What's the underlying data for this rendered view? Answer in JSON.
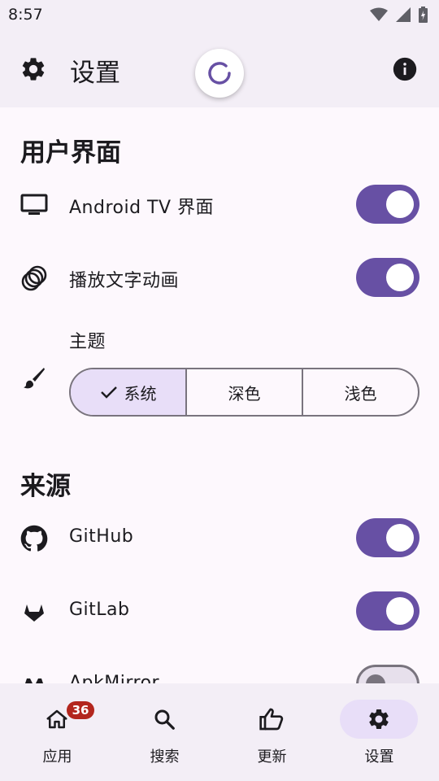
{
  "status_bar": {
    "time": "8:57"
  },
  "app_bar": {
    "title": "设置"
  },
  "sections": {
    "ui": {
      "title": "用户界面",
      "android_tv": {
        "label": "Android TV 界面",
        "enabled": true
      },
      "animations": {
        "label": "播放文字动画",
        "enabled": true
      },
      "theme": {
        "label": "主题",
        "options": [
          "系统",
          "深色",
          "浅色"
        ],
        "selected": "系统"
      }
    },
    "sources": {
      "title": "来源",
      "github": {
        "label": "GitHub",
        "enabled": true
      },
      "gitlab": {
        "label": "GitLab",
        "enabled": true
      },
      "apkmirror": {
        "label": "ApkMirror",
        "enabled": false
      }
    }
  },
  "bottom_nav": {
    "apps": {
      "label": "应用",
      "badge": "36"
    },
    "search": {
      "label": "搜索"
    },
    "updates": {
      "label": "更新"
    },
    "settings": {
      "label": "设置",
      "active": true
    }
  },
  "colors": {
    "accent": "#6750a4",
    "surface": "#f3eef6",
    "indicator": "#e8def8",
    "badge": "#b3261e"
  }
}
